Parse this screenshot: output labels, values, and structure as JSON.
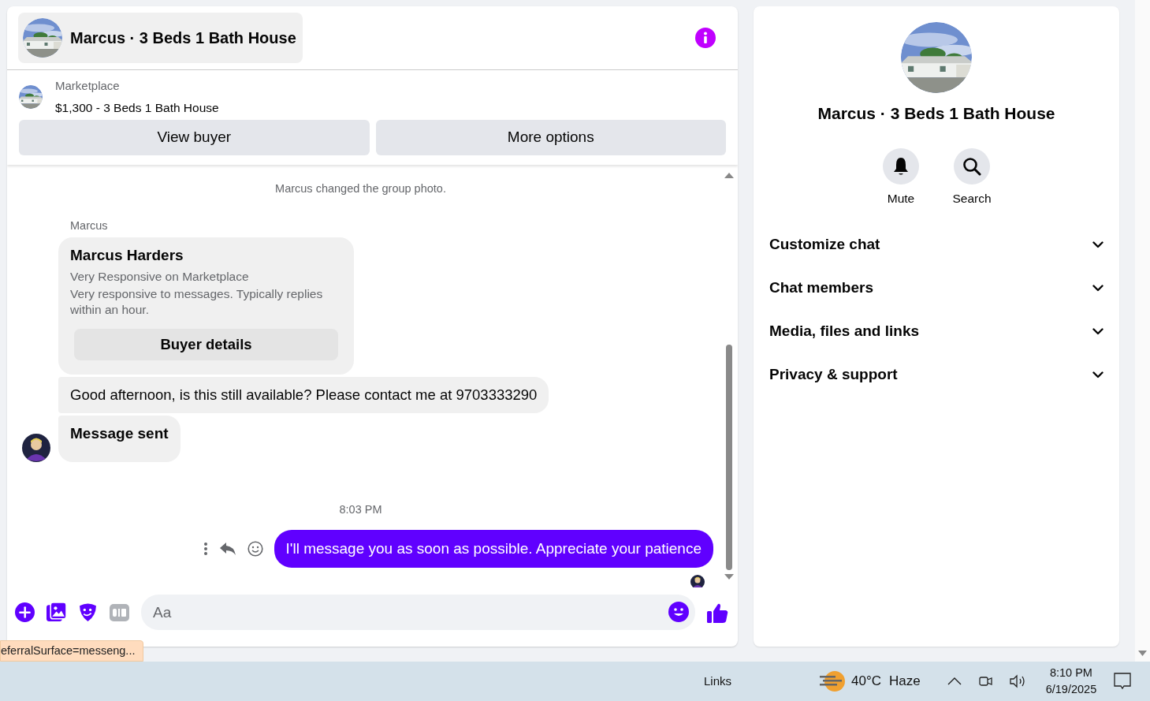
{
  "header": {
    "title": "Marcus · 3 Beds 1 Bath House"
  },
  "listing": {
    "source": "Marketplace",
    "title": "$1,300 - 3 Beds 1 Bath House",
    "buttons": [
      "View buyer",
      "More options"
    ]
  },
  "messages": [
    {
      "kind": "event",
      "text": "Marcus changed the group photo."
    },
    {
      "kind": "sender",
      "text": "Marcus"
    },
    {
      "kind": "card",
      "name": "Marcus Harders",
      "lines": [
        "Very Responsive on Marketplace",
        "Very responsive to messages. Typically replies within an hour."
      ],
      "button": "Buyer details"
    },
    {
      "kind": "incoming",
      "text": "Good afternoon, is this still available? Please contact me at 9703333290",
      "bold": false,
      "avatar": false
    },
    {
      "kind": "incoming",
      "text": "Message sent",
      "bold": true,
      "avatar": true
    },
    {
      "kind": "time",
      "text": "8:03 PM"
    },
    {
      "kind": "outgoing",
      "text": "I'll message you as soon as possible. Appreciate your patience",
      "read": true
    }
  ],
  "composer": {
    "placeholder": "Aa"
  },
  "details": {
    "title": "Marcus · 3 Beds 1 Bath House",
    "actions": [
      {
        "kind": "mute",
        "label": "Mute"
      },
      {
        "kind": "search",
        "label": "Search"
      }
    ],
    "sections": [
      {
        "label": "Customize chat",
        "expanded": false
      },
      {
        "label": "Chat members",
        "expanded": false
      },
      {
        "label": "Media, files and links",
        "expanded": false
      },
      {
        "label": "Privacy & support",
        "expanded": false
      }
    ]
  },
  "status_link": "eferralSurface=messeng...",
  "taskbar": {
    "links": "Links",
    "temperature": "40°C",
    "condition": "Haze",
    "time": "8:10 PM",
    "date": "6/19/2025"
  }
}
